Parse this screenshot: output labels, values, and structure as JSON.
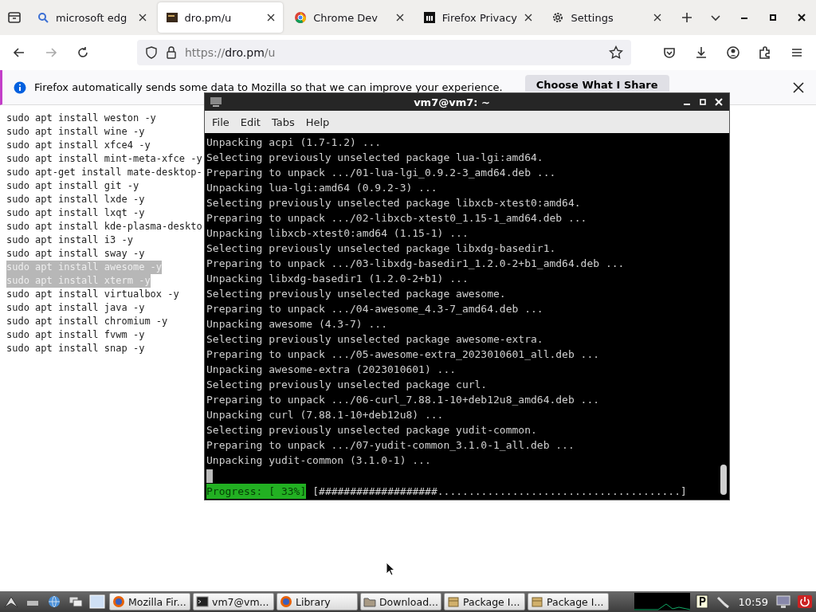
{
  "browser": {
    "tabs": [
      {
        "label": "microsoft edg",
        "kind": "search",
        "selected": false
      },
      {
        "label": "dro.pm/u",
        "kind": "site",
        "selected": true
      },
      {
        "label": "Chrome Dev",
        "kind": "chrome",
        "selected": false
      },
      {
        "label": "Firefox Privacy",
        "kind": "letter",
        "selected": false
      },
      {
        "label": "Settings",
        "kind": "gear",
        "selected": false
      }
    ],
    "url": {
      "prefix": "https://",
      "host": "dro.pm",
      "path": "/u"
    },
    "notification": {
      "text": "Firefox automatically sends some data to Mozilla so that we can improve your experience.",
      "button": "Choose What I Share"
    },
    "page_lines": [
      {
        "text": "sudo apt install weston -y",
        "selected": false
      },
      {
        "text": "sudo apt install wine -y",
        "selected": false
      },
      {
        "text": "sudo apt install xfce4 -y",
        "selected": false
      },
      {
        "text": "sudo apt install mint-meta-xfce -y",
        "selected": false
      },
      {
        "text": "sudo apt-get install mate-desktop-",
        "selected": false
      },
      {
        "text": "sudo apt install git -y",
        "selected": false
      },
      {
        "text": "sudo apt install lxde -y",
        "selected": false
      },
      {
        "text": "sudo apt install lxqt -y",
        "selected": false
      },
      {
        "text": "sudo apt install kde-plasma-deskto",
        "selected": false
      },
      {
        "text": "sudo apt install i3 -y",
        "selected": false
      },
      {
        "text": "sudo apt install sway -y",
        "selected": false
      },
      {
        "text": "sudo apt install awesome -y",
        "selected": true
      },
      {
        "text": "sudo apt install xterm -y",
        "selected": true
      },
      {
        "text": "sudo apt install virtualbox -y",
        "selected": false
      },
      {
        "text": "sudo apt install java -y",
        "selected": false
      },
      {
        "text": "sudo apt install chromium -y",
        "selected": false
      },
      {
        "text": "sudo apt install fvwm -y",
        "selected": false
      },
      {
        "text": "sudo apt install snap -y",
        "selected": false
      }
    ]
  },
  "terminal": {
    "title": "vm7@vm7: ~",
    "menu": [
      "File",
      "Edit",
      "Tabs",
      "Help"
    ],
    "lines": [
      "Unpacking acpi (1.7-1.2) ...",
      "Selecting previously unselected package lua-lgi:amd64.",
      "Preparing to unpack .../01-lua-lgi_0.9.2-3_amd64.deb ...",
      "Unpacking lua-lgi:amd64 (0.9.2-3) ...",
      "Selecting previously unselected package libxcb-xtest0:amd64.",
      "Preparing to unpack .../02-libxcb-xtest0_1.15-1_amd64.deb ...",
      "Unpacking libxcb-xtest0:amd64 (1.15-1) ...",
      "Selecting previously unselected package libxdg-basedir1.",
      "Preparing to unpack .../03-libxdg-basedir1_1.2.0-2+b1_amd64.deb ...",
      "Unpacking libxdg-basedir1 (1.2.0-2+b1) ...",
      "Selecting previously unselected package awesome.",
      "Preparing to unpack .../04-awesome_4.3-7_amd64.deb ...",
      "Unpacking awesome (4.3-7) ...",
      "Selecting previously unselected package awesome-extra.",
      "Preparing to unpack .../05-awesome-extra_2023010601_all.deb ...",
      "Unpacking awesome-extra (2023010601) ...",
      "Selecting previously unselected package curl.",
      "Preparing to unpack .../06-curl_7.88.1-10+deb12u8_amd64.deb ...",
      "Unpacking curl (7.88.1-10+deb12u8) ...",
      "Selecting previously unselected package yudit-common.",
      "Preparing to unpack .../07-yudit-common_3.1.0-1_all.deb ...",
      "Unpacking yudit-common (3.1.0-1) ..."
    ],
    "progress_label": "Progress: [ 33%]",
    "progress_bar": "[###################.......................................]"
  },
  "taskbar": {
    "items": [
      {
        "label": "Mozilla Fir...",
        "kind": "firefox"
      },
      {
        "label": "vm7@vm...",
        "kind": "terminal"
      },
      {
        "label": "Library",
        "kind": "firefox"
      },
      {
        "label": "Download...",
        "kind": "folder"
      },
      {
        "label": "Package I...",
        "kind": "package"
      },
      {
        "label": "Package I...",
        "kind": "package"
      }
    ],
    "clock": "10:59"
  }
}
